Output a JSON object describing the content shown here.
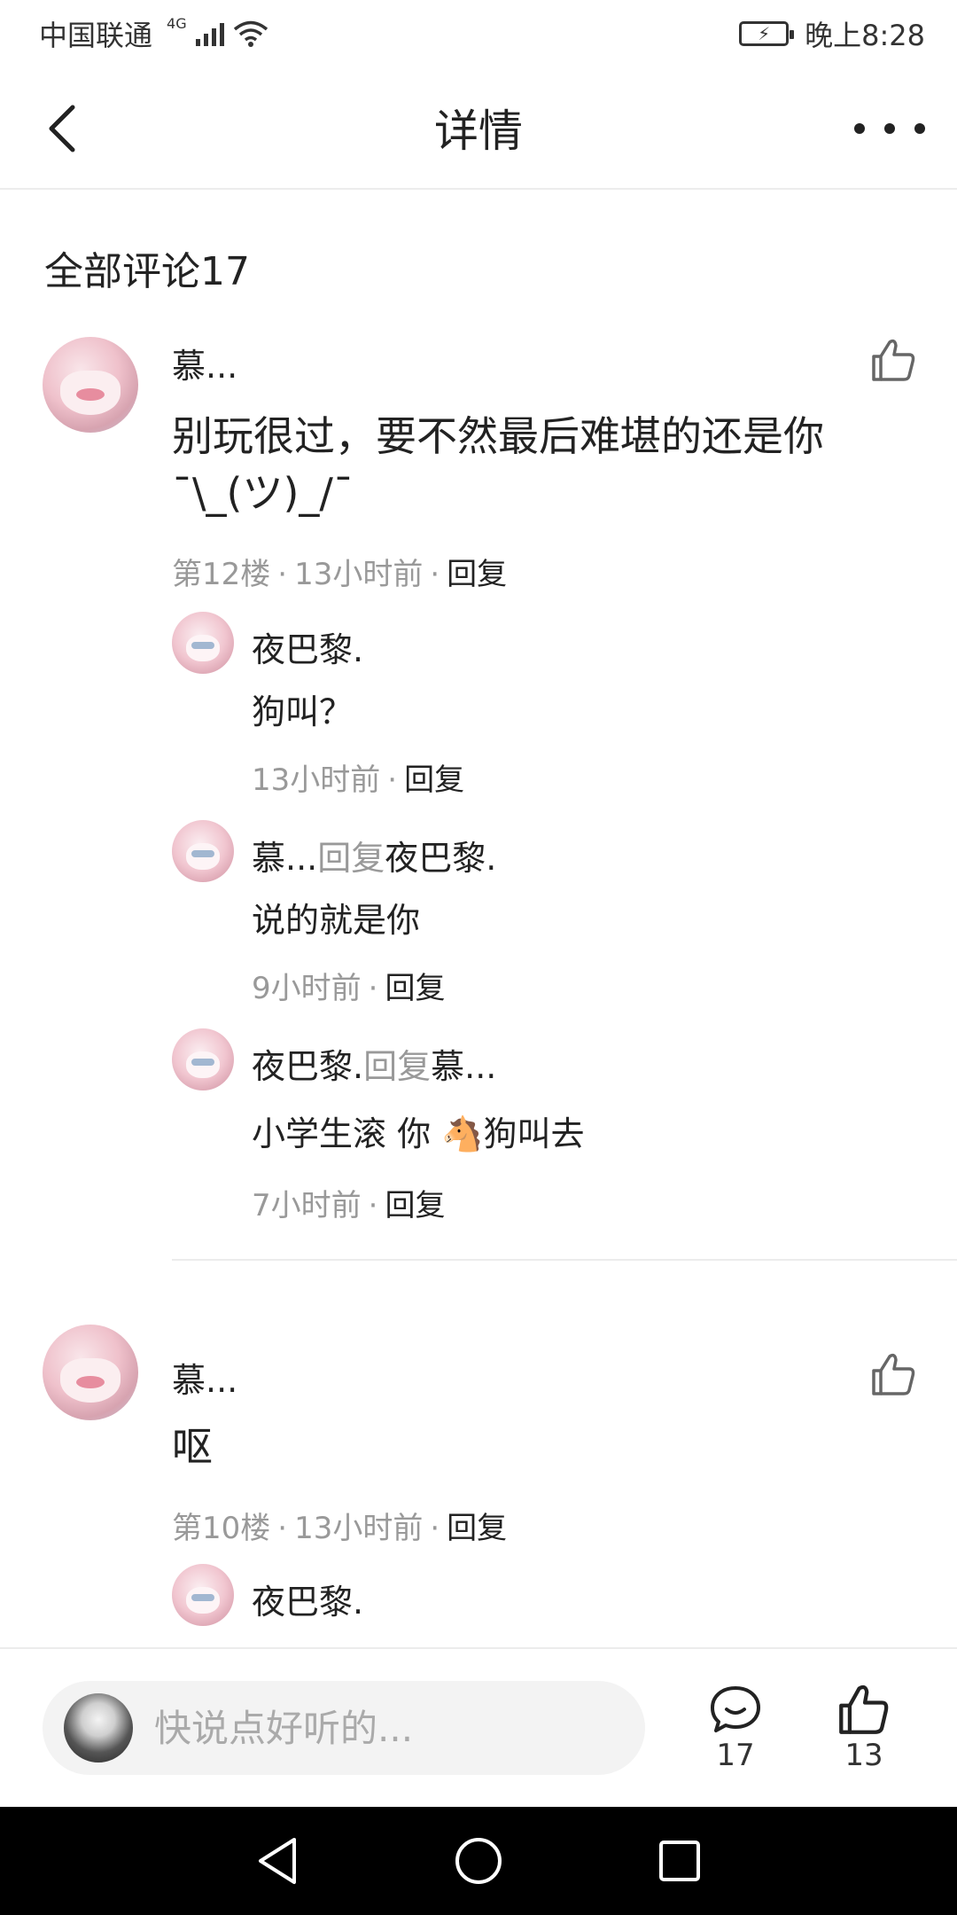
{
  "status_bar": {
    "carrier": "中国联通",
    "network": "4G",
    "time": "晚上8:28"
  },
  "header": {
    "title": "详情"
  },
  "comments_section": {
    "title": "全部评论17"
  },
  "comments": [
    {
      "username": "慕...",
      "text": "别玩很过，要不然最后难堪的还是你¯\\_(ツ)_/¯",
      "floor": "第12楼",
      "time": "13小时前",
      "reply_label": "回复",
      "replies": [
        {
          "name": "夜巴黎.",
          "reply_word": "",
          "target": "",
          "text": "狗叫？",
          "time": "13小时前",
          "reply_label": "回复"
        },
        {
          "name": "慕...",
          "reply_word": "回复",
          "target": "夜巴黎.",
          "text": "说的就是你",
          "time": "9小时前",
          "reply_label": "回复"
        },
        {
          "name": "夜巴黎.",
          "reply_word": "回复",
          "target": "慕...",
          "text": "小学生滚 你 🐴狗叫去",
          "time": "7小时前",
          "reply_label": "回复"
        }
      ]
    },
    {
      "username": "慕...",
      "text": "呕",
      "floor": "第10楼",
      "time": "13小时前",
      "reply_label": "回复",
      "replies": [
        {
          "name": "夜巴黎.",
          "reply_word": "",
          "target": "",
          "text": "",
          "time": "",
          "reply_label": ""
        }
      ]
    }
  ],
  "bottom_bar": {
    "input_placeholder": "快说点好听的...",
    "comment_count": "17",
    "like_count": "13"
  },
  "icons": {
    "back": "back-arrow-icon",
    "more": "more-dots-icon",
    "like": "thumbs-up-icon",
    "comment": "comment-bubble-icon"
  }
}
